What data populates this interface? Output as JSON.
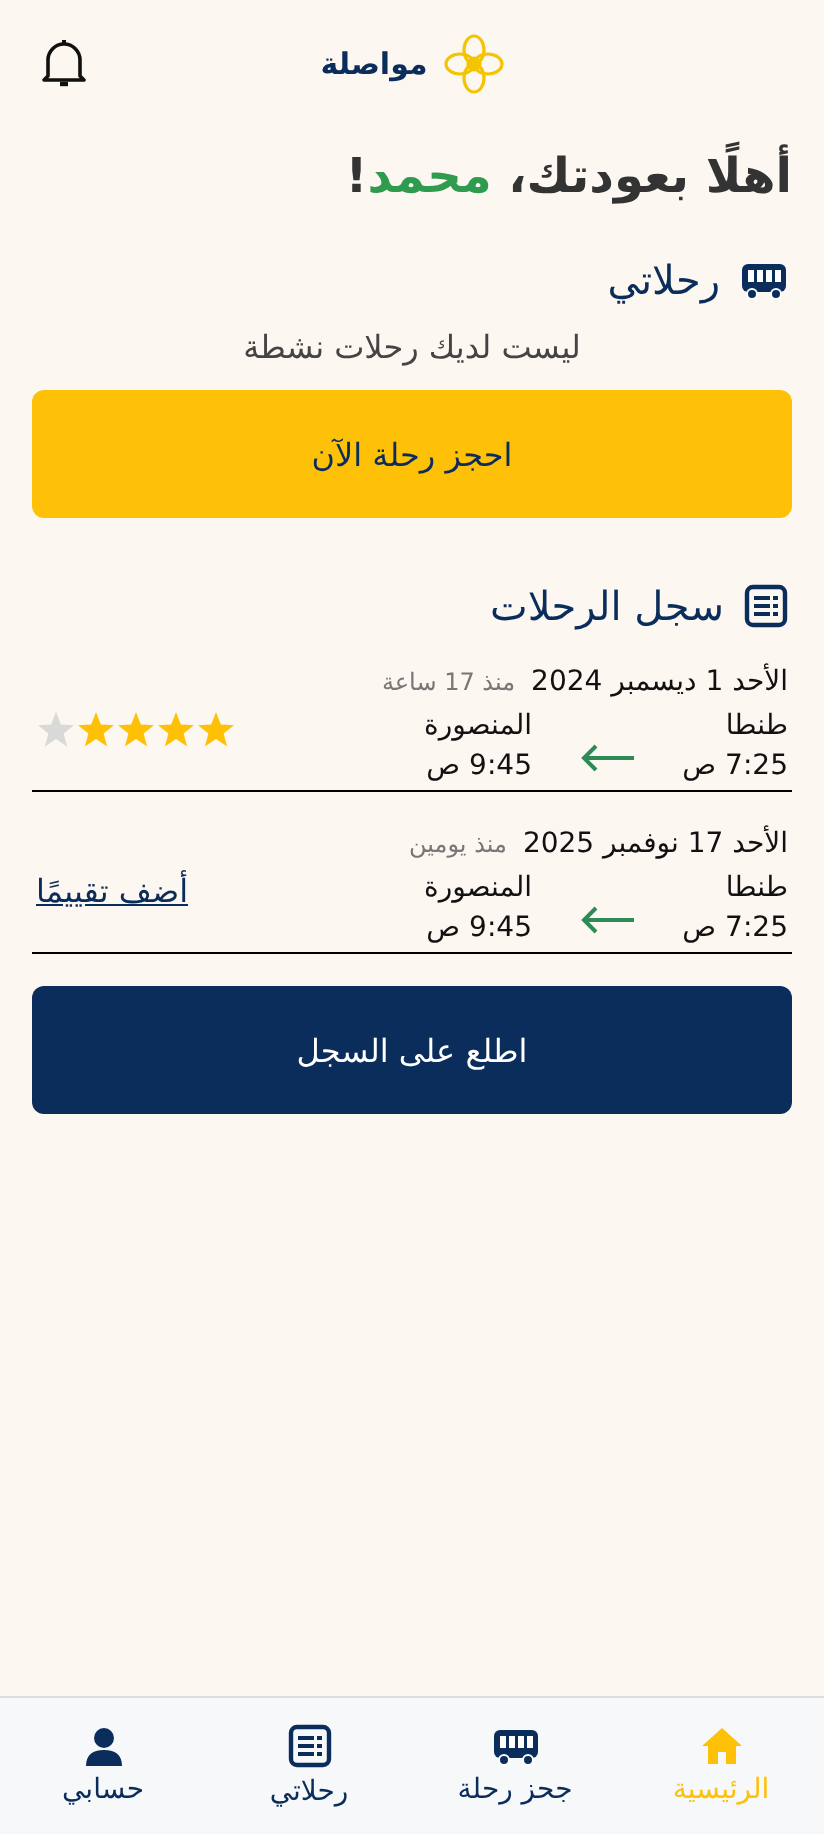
{
  "header": {
    "app_name": "مواصلة"
  },
  "greeting": {
    "prefix": "أهلًا بعودتك، ",
    "name": "محمد",
    "suffix": "!"
  },
  "my_trips": {
    "title": "رحلاتي",
    "empty_message": "ليست لديك رحلات نشطة",
    "book_button": "احجز رحلة الآن"
  },
  "history": {
    "title": "سجل الرحلات",
    "trips": [
      {
        "kind": "rated",
        "date": "الأحد  1 ديسمبر 2024",
        "ago": "منذ 17 ساعة",
        "from": "طنطا",
        "from_time": "7:25 ص",
        "to": "المنصورة",
        "to_time": "9:45 ص",
        "stars": 4
      },
      {
        "kind": "unrated",
        "date": "الأحد  17 نوفمبر 2025",
        "ago": "منذ يومين",
        "from": "طنطا",
        "from_time": "7:25 ص",
        "to": "المنصورة",
        "to_time": "9:45 ص",
        "rate_link": "أضف تقييمًا"
      }
    ],
    "view_button": "اطلع على السجل"
  },
  "nav": [
    {
      "kind": "home",
      "label": "الرئيسية",
      "selected": true
    },
    {
      "kind": "bus",
      "label": "جحز رحلة",
      "selected": false
    },
    {
      "kind": "list",
      "label": "رحلاتي",
      "selected": false
    },
    {
      "kind": "person",
      "label": "حسابي",
      "selected": false
    }
  ]
}
